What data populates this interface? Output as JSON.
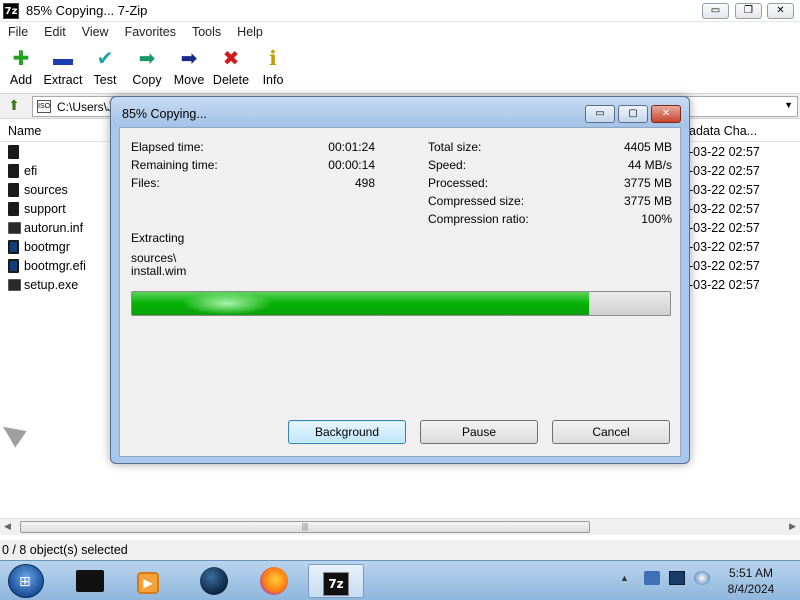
{
  "window": {
    "title": "85% Copying... 7-Zip",
    "app_icon_text": "7z",
    "controls": {
      "minimize": "▭",
      "maximize": "❐",
      "close": "✕"
    }
  },
  "menu": [
    "File",
    "Edit",
    "View",
    "Favorites",
    "Tools",
    "Help"
  ],
  "toolbar": [
    {
      "label": "Add",
      "icon": "plus-icon",
      "glyph": "✚",
      "color": "#1fa31f"
    },
    {
      "label": "Extract",
      "icon": "minus-icon",
      "glyph": "▬",
      "color": "#1d3fb5"
    },
    {
      "label": "Test",
      "icon": "check-arrow-icon",
      "glyph": "✔",
      "color": "#18a6a6"
    },
    {
      "label": "Copy",
      "icon": "copy-arrow-icon",
      "glyph": "➡",
      "color": "#1a9a6a"
    },
    {
      "label": "Move",
      "icon": "move-arrow-icon",
      "glyph": "➡",
      "color": "#1a2a8a"
    },
    {
      "label": "Delete",
      "icon": "delete-x-icon",
      "glyph": "✖",
      "color": "#d21a1a"
    },
    {
      "label": "Info",
      "icon": "info-icon",
      "glyph": "ℹ",
      "color": "#c49a00"
    }
  ],
  "address": {
    "path": "C:\\Users\\J",
    "icon_text": "ISO"
  },
  "columns": {
    "name": "Name",
    "date": "adata Cha..."
  },
  "files": [
    {
      "name": "",
      "date": "-03-22 02:57",
      "icon": "folder-icon",
      "kind": "folder"
    },
    {
      "name": "efi",
      "date": "-03-22 02:57",
      "icon": "folder-icon",
      "kind": "folder"
    },
    {
      "name": "sources",
      "date": "-03-22 02:57",
      "icon": "folder-icon",
      "kind": "folder"
    },
    {
      "name": "support",
      "date": "-03-22 02:57",
      "icon": "folder-icon",
      "kind": "folder"
    },
    {
      "name": "autorun.inf",
      "date": "-03-22 02:57",
      "icon": "inf-file-icon",
      "kind": "exe"
    },
    {
      "name": "bootmgr",
      "date": "-03-22 02:57",
      "icon": "file-icon",
      "kind": "blue"
    },
    {
      "name": "bootmgr.efi",
      "date": "-03-22 02:57",
      "icon": "file-icon",
      "kind": "blue"
    },
    {
      "name": "setup.exe",
      "date": "-03-22 02:57",
      "icon": "setup-exe-icon",
      "kind": "exe"
    }
  ],
  "status": "0 / 8 object(s) selected",
  "dialog": {
    "title": "85% Copying...",
    "controls": {
      "minimize": "▭",
      "maximize": "▢",
      "close": "✕"
    },
    "left_labels": {
      "elapsed": "Elapsed time:",
      "remaining": "Remaining time:",
      "files": "Files:"
    },
    "left_values": {
      "elapsed": "00:01:24",
      "remaining": "00:00:14",
      "files": "498"
    },
    "right_labels": {
      "total": "Total size:",
      "speed": "Speed:",
      "processed": "Processed:",
      "compressed": "Compressed size:",
      "ratio": "Compression ratio:"
    },
    "right_values": {
      "total": "4405 MB",
      "speed": "44 MB/s",
      "processed": "3775 MB",
      "compressed": "3775 MB",
      "ratio": "100%"
    },
    "operation": "Extracting",
    "current_folder": "sources\\",
    "current_file": "install.wim",
    "progress_percent": 85,
    "buttons": {
      "background": "Background",
      "pause": "Pause",
      "cancel": "Cancel"
    }
  },
  "taskbar": {
    "apps": [
      {
        "name": "file-manager",
        "icon": "folder-dark-icon"
      },
      {
        "name": "media-player",
        "icon": "media-player-icon"
      },
      {
        "name": "browser-globe",
        "icon": "globe-icon"
      },
      {
        "name": "firefox",
        "icon": "firefox-icon"
      },
      {
        "name": "7-zip",
        "icon": "7zip-icon",
        "text": "7z",
        "active": true
      }
    ],
    "tray_arrow": "▲",
    "time": "5:51 AM",
    "date": "8/4/2024"
  }
}
